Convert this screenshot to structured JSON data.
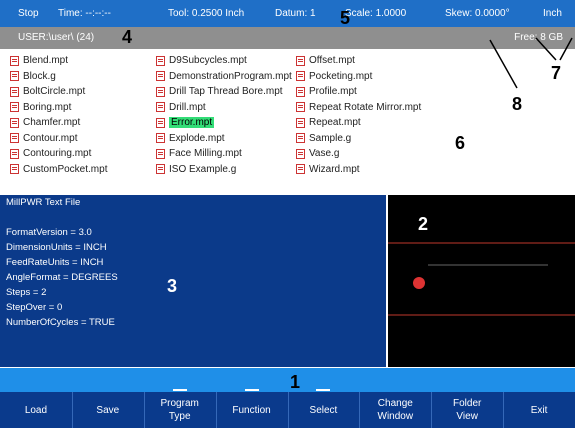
{
  "status": {
    "mode": "Stop",
    "time": "Time: --:--:--",
    "tool": "Tool: 0.2500 Inch",
    "datum": "Datum: 1",
    "scale": "Scale: 1.0000",
    "skew": "Skew: 0.0000°",
    "units": "Inch"
  },
  "pathbar": {
    "path": "USER:\\user\\ (24)",
    "free": "Free: 8 GB"
  },
  "files": {
    "col1": [
      "Blend.mpt",
      "Block.g",
      "BoltCircle.mpt",
      "Boring.mpt",
      "Chamfer.mpt",
      "Contour.mpt",
      "Contouring.mpt",
      "CustomPocket.mpt"
    ],
    "col2": [
      "D9Subcycles.mpt",
      "DemonstrationProgram.mpt",
      "Drill Tap Thread Bore.mpt",
      "Drill.mpt",
      "Error.mpt",
      "Explode.mpt",
      "Face Milling.mpt",
      "ISO Example.g"
    ],
    "col3": [
      "Offset.mpt",
      "Pocketing.mpt",
      "Profile.mpt",
      "Repeat Rotate Mirror.mpt",
      "Repeat.mpt",
      "Sample.g",
      "Vase.g",
      "Wizard.mpt"
    ],
    "selected": "Error.mpt"
  },
  "preview": {
    "lines": [
      "MillPWR Text File",
      "",
      "FormatVersion = 3.0",
      "DimensionUnits = INCH",
      "FeedRateUnits = INCH",
      "AngleFormat = DEGREES",
      "Steps = 2",
      "StepOver = 0",
      "NumberOfCycles = TRUE"
    ]
  },
  "softkeys": [
    {
      "label": "Load"
    },
    {
      "label": "Save"
    },
    {
      "label": "Program\nType"
    },
    {
      "label": "Function"
    },
    {
      "label": "Select"
    },
    {
      "label": "Change\nWindow"
    },
    {
      "label": "Folder\nView"
    },
    {
      "label": "Exit"
    }
  ],
  "callouts": [
    "1",
    "2",
    "3",
    "4",
    "5",
    "6",
    "7",
    "8"
  ],
  "colors": {
    "status_bar": "#1f6fc7",
    "path_bar": "#8f8f8f",
    "preview_bg": "#0b3a8a",
    "selected": "#33dd77",
    "softkey_bg": "#0a3a8c"
  }
}
